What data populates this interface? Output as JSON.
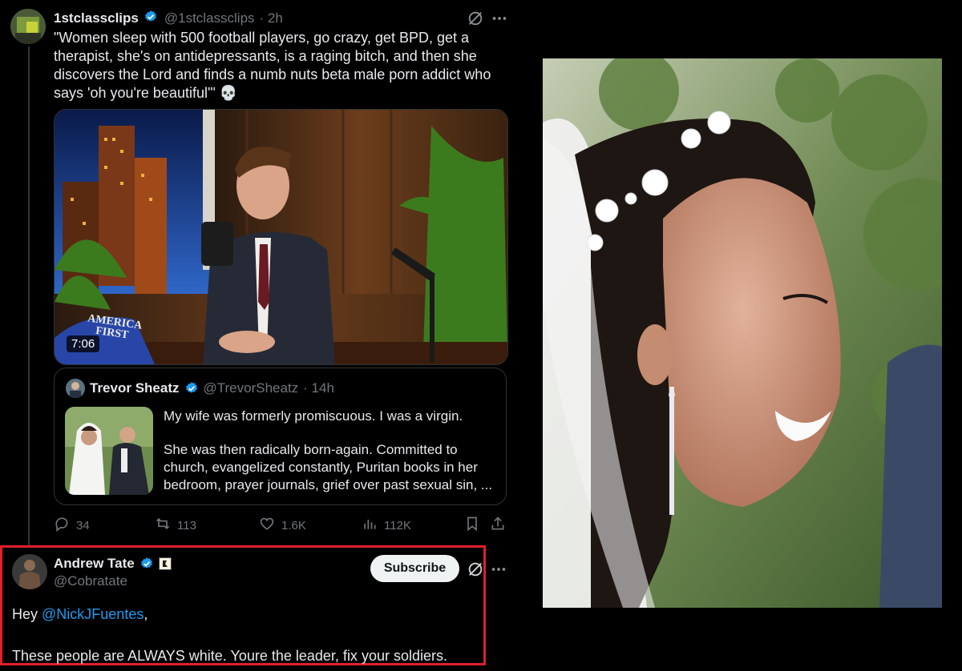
{
  "tweet1": {
    "author_name": "1stclassclips",
    "author_handle": "@1stclassclips",
    "time": "· 2h",
    "text": "\"Women sleep with 500 football players, go crazy, get BPD, get a therapist, she's on antidepressants, is a raging bitch, and then she discovers the Lord and finds a numb nuts beta male porn addict who says 'oh you're beautiful'\"",
    "emoji": "💀",
    "video": {
      "duration": "7:06",
      "hat_text_1": "AMERICA",
      "hat_text_2": "FIRST"
    },
    "quote": {
      "author_name": "Trevor Sheatz",
      "author_handle": "@TrevorSheatz",
      "time": "· 14h",
      "text_p1": "My wife was formerly promiscuous. I was a virgin.",
      "text_p2": "She was then radically born-again. Committed to church, evangelized constantly, Puritan books in her bedroom, prayer journals, grief over past sexual sin, ..."
    },
    "stats": {
      "replies": "34",
      "retweets": "113",
      "likes": "1.6K",
      "views": "112K"
    }
  },
  "tweet2": {
    "author_name": "Andrew Tate",
    "author_handle": "@Cobratate",
    "subscribe_label": "Subscribe",
    "text_prefix": "Hey ",
    "mention": "@NickJFuentes",
    "text_suffix": ",",
    "text_line2": "These people are ALWAYS white. Youre the leader, fix your soldiers."
  },
  "colors": {
    "accent": "#1d9bf0",
    "highlight_border": "#e0202a",
    "background": "#000000"
  }
}
